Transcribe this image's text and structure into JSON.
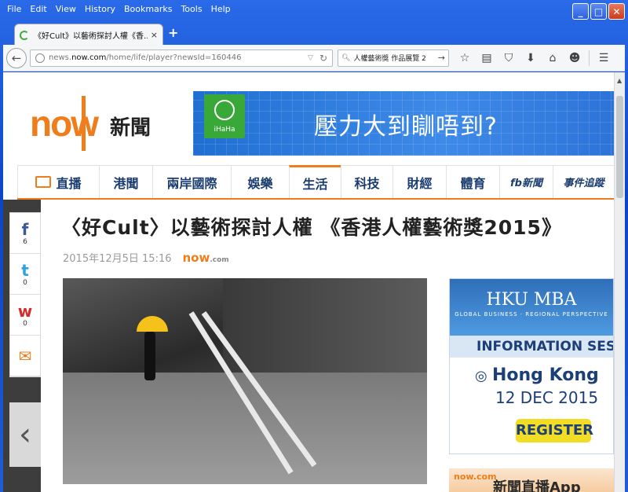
{
  "menu": [
    "File",
    "Edit",
    "View",
    "History",
    "Bookmarks",
    "Tools",
    "Help"
  ],
  "window_buttons": {
    "minimize": "_",
    "maximize": "□",
    "close": "✕"
  },
  "tab": {
    "title": "《好Cult》以藝術探討人權《香...",
    "close": "×",
    "new_tab": "+"
  },
  "nav": {
    "url_domain_prefix": "news.",
    "url_domain": "now.com",
    "url_path": "/home/life/player?newsId=160446",
    "search_value": "人權藝術獎 作品展覽 2"
  },
  "header": {
    "logo_text": "now",
    "logo_zh": "新聞",
    "banner_brand": "iHaHa",
    "banner_slogan": "壓力大到瞓唔到?"
  },
  "topnav": [
    "直播",
    "港聞",
    "兩岸國際",
    "娛樂",
    "生活",
    "科技",
    "財經",
    "體育",
    "fb新聞",
    "事件追蹤"
  ],
  "share": [
    {
      "icon": "f",
      "count": "6"
    },
    {
      "icon": "t",
      "count": "0"
    },
    {
      "icon": "w",
      "count": "0"
    },
    {
      "icon": "✉",
      "count": ""
    }
  ],
  "article": {
    "title": "〈好Cult〉以藝術探討人權 《香港人權藝術獎2015》",
    "date": "2015年12月5日 15:16",
    "source": "now",
    "source_suffix": ".com"
  },
  "ad": {
    "brand": "HKU MBA",
    "tagline": "GLOBAL BUSINESS · REGIONAL PERSPECTIVE",
    "headline": "INFORMATION SESSION",
    "city": "Hong Kong",
    "date": "12 DEC 2015",
    "cta": "REGISTER"
  },
  "ad2": {
    "brand": "now.com",
    "text": "新聞直播App"
  },
  "colors": {
    "accent": "#f07d1b",
    "nav_text": "#1b3d6f",
    "titlebar": "#0b45c8"
  }
}
